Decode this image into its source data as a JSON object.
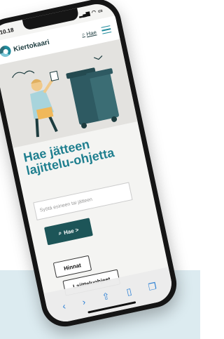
{
  "status": {
    "time": "10.18"
  },
  "header": {
    "logo_text": "Kiertokaari",
    "search_label": "Hae"
  },
  "main": {
    "title": "Hae jätteen lajittelu-ohjetta",
    "search_placeholder": "Syötä esineen tai jätteen",
    "search_button_label": "Hae >",
    "quick_links": [
      "Hinnat",
      "Lajitteluohjeet"
    ]
  },
  "browser": {
    "back_icon": "chevron-left-icon",
    "forward_icon": "chevron-right-icon",
    "share_icon": "share-icon",
    "bookmarks_icon": "book-icon",
    "tabs_icon": "tabs-icon"
  }
}
